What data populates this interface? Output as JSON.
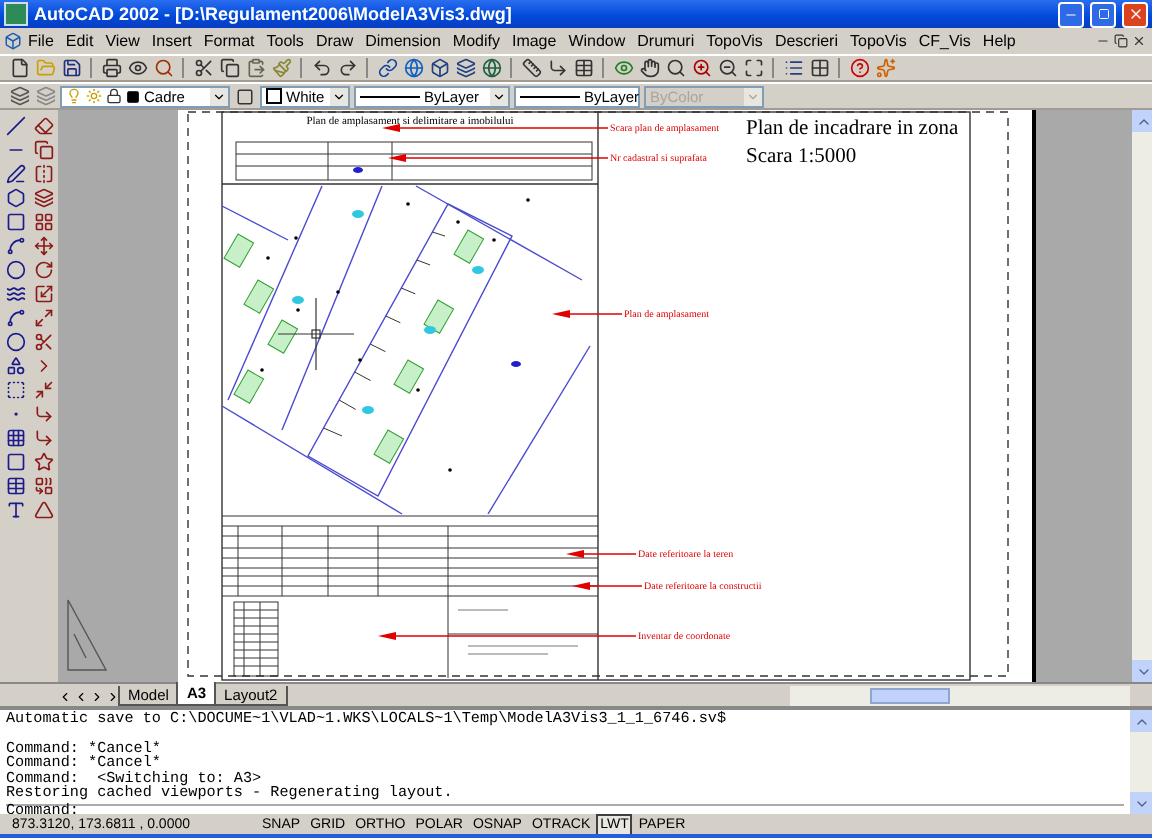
{
  "window": {
    "title": "AutoCAD 2002 - [D:\\Regulament2006\\ModelA3Vis3.dwg]"
  },
  "menu": [
    "File",
    "Edit",
    "View",
    "Insert",
    "Format",
    "Tools",
    "Draw",
    "Dimension",
    "Modify",
    "Image",
    "Window",
    "Drumuri",
    "TopoVis",
    "Descrieri",
    "TopoVis",
    "CF_Vis",
    "Help"
  ],
  "property_controls": [
    {
      "kind": "layer",
      "value": "Cadre",
      "disabled": false
    },
    {
      "kind": "color",
      "value": "White",
      "disabled": false
    },
    {
      "kind": "linetype",
      "value": "ByLayer",
      "disabled": false
    },
    {
      "kind": "lineweight",
      "value": "ByLayer",
      "disabled": false
    },
    {
      "kind": "plotstyle",
      "value": "ByColor",
      "disabled": true
    }
  ],
  "drawing": {
    "sheet_title": "Plan de amplasament si delimitare a imobilului",
    "inset_lines": [
      "Plan de incadrare in zona",
      "Scara 1:5000"
    ],
    "annotations": [
      "Scara plan de amplasament",
      "Nr cadastral si suprafata",
      "Plan de amplasament",
      "Date referitoare la teren",
      "Date referitoare la constructii",
      "Inventar de coordonate"
    ]
  },
  "layout_tabs": [
    {
      "label": "Model",
      "selected": false
    },
    {
      "label": "A3",
      "selected": true
    },
    {
      "label": "Layout2",
      "selected": false
    }
  ],
  "command_history": [
    "Automatic save to C:\\DOCUME~1\\VLAD~1.WKS\\LOCALS~1\\Temp\\ModelA3Vis3_1_1_6746.sv$",
    "Command: *Cancel*",
    "Command: *Cancel*",
    "Command:  <Switching to: A3>",
    "Restoring cached viewports - Regenerating layout."
  ],
  "command_prompt": "Command:",
  "status_bar": {
    "coordinates": "873.3120, 173.6811 , 0.0000",
    "toggles": [
      {
        "label": "SNAP",
        "on": false
      },
      {
        "label": "GRID",
        "on": false
      },
      {
        "label": "ORTHO",
        "on": false
      },
      {
        "label": "POLAR",
        "on": false
      },
      {
        "label": "OSNAP",
        "on": false
      },
      {
        "label": "OTRACK",
        "on": false
      },
      {
        "label": "LWT",
        "on": true
      },
      {
        "label": "PAPER",
        "on": false
      }
    ]
  }
}
